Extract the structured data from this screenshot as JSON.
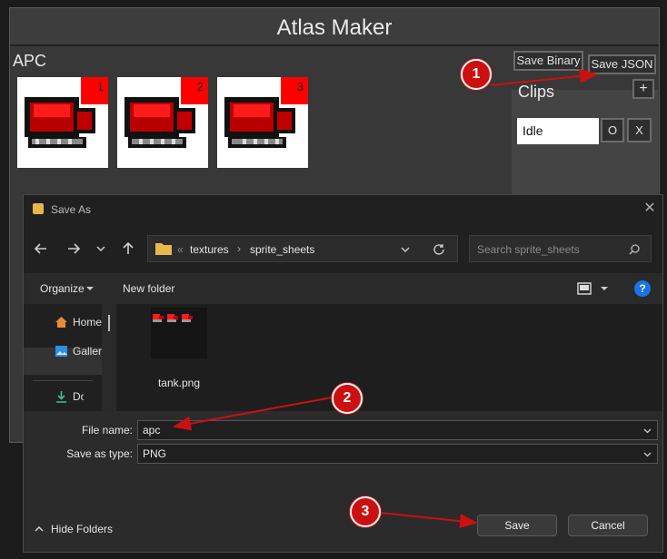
{
  "atlas": {
    "title": "Atlas Maker",
    "sheet_name": "APC",
    "frames": [
      {
        "label": "1"
      },
      {
        "label": "2"
      },
      {
        "label": "3"
      }
    ],
    "save_binary_label": "Save Binary",
    "save_json_label": "Save JSON",
    "clips_label": "Clips",
    "add_clip_label": "+",
    "clip_row": {
      "name": "Idle",
      "open_label": "O",
      "delete_label": "X"
    }
  },
  "dialog": {
    "title": "Save As",
    "close_label": "✕",
    "breadcrumb": {
      "prefix": "«",
      "items": [
        "textures",
        "sprite_sheets"
      ]
    },
    "search_placeholder": "Search sprite_sheets",
    "toolbar": {
      "organize_label": "Organize",
      "new_folder_label": "New folder"
    },
    "nav_items": [
      {
        "label": "Home",
        "icon": "home-icon"
      },
      {
        "label": "Gallery",
        "icon": "gallery-icon"
      },
      {
        "label": "Downloads",
        "icon": "download-icon"
      }
    ],
    "files": [
      {
        "name": "tank.png"
      }
    ],
    "file_name_label": "File name:",
    "file_name_value": "apc",
    "save_type_label": "Save as type:",
    "save_type_value": "PNG",
    "hide_folders_label": "Hide Folders",
    "save_label": "Save",
    "cancel_label": "Cancel"
  },
  "annotations": [
    {
      "number": "1"
    },
    {
      "number": "2"
    },
    {
      "number": "3"
    }
  ],
  "colors": {
    "accent_red": "#cc1010",
    "sprite_red": "#ff0000",
    "help_blue": "#1a73e8"
  }
}
